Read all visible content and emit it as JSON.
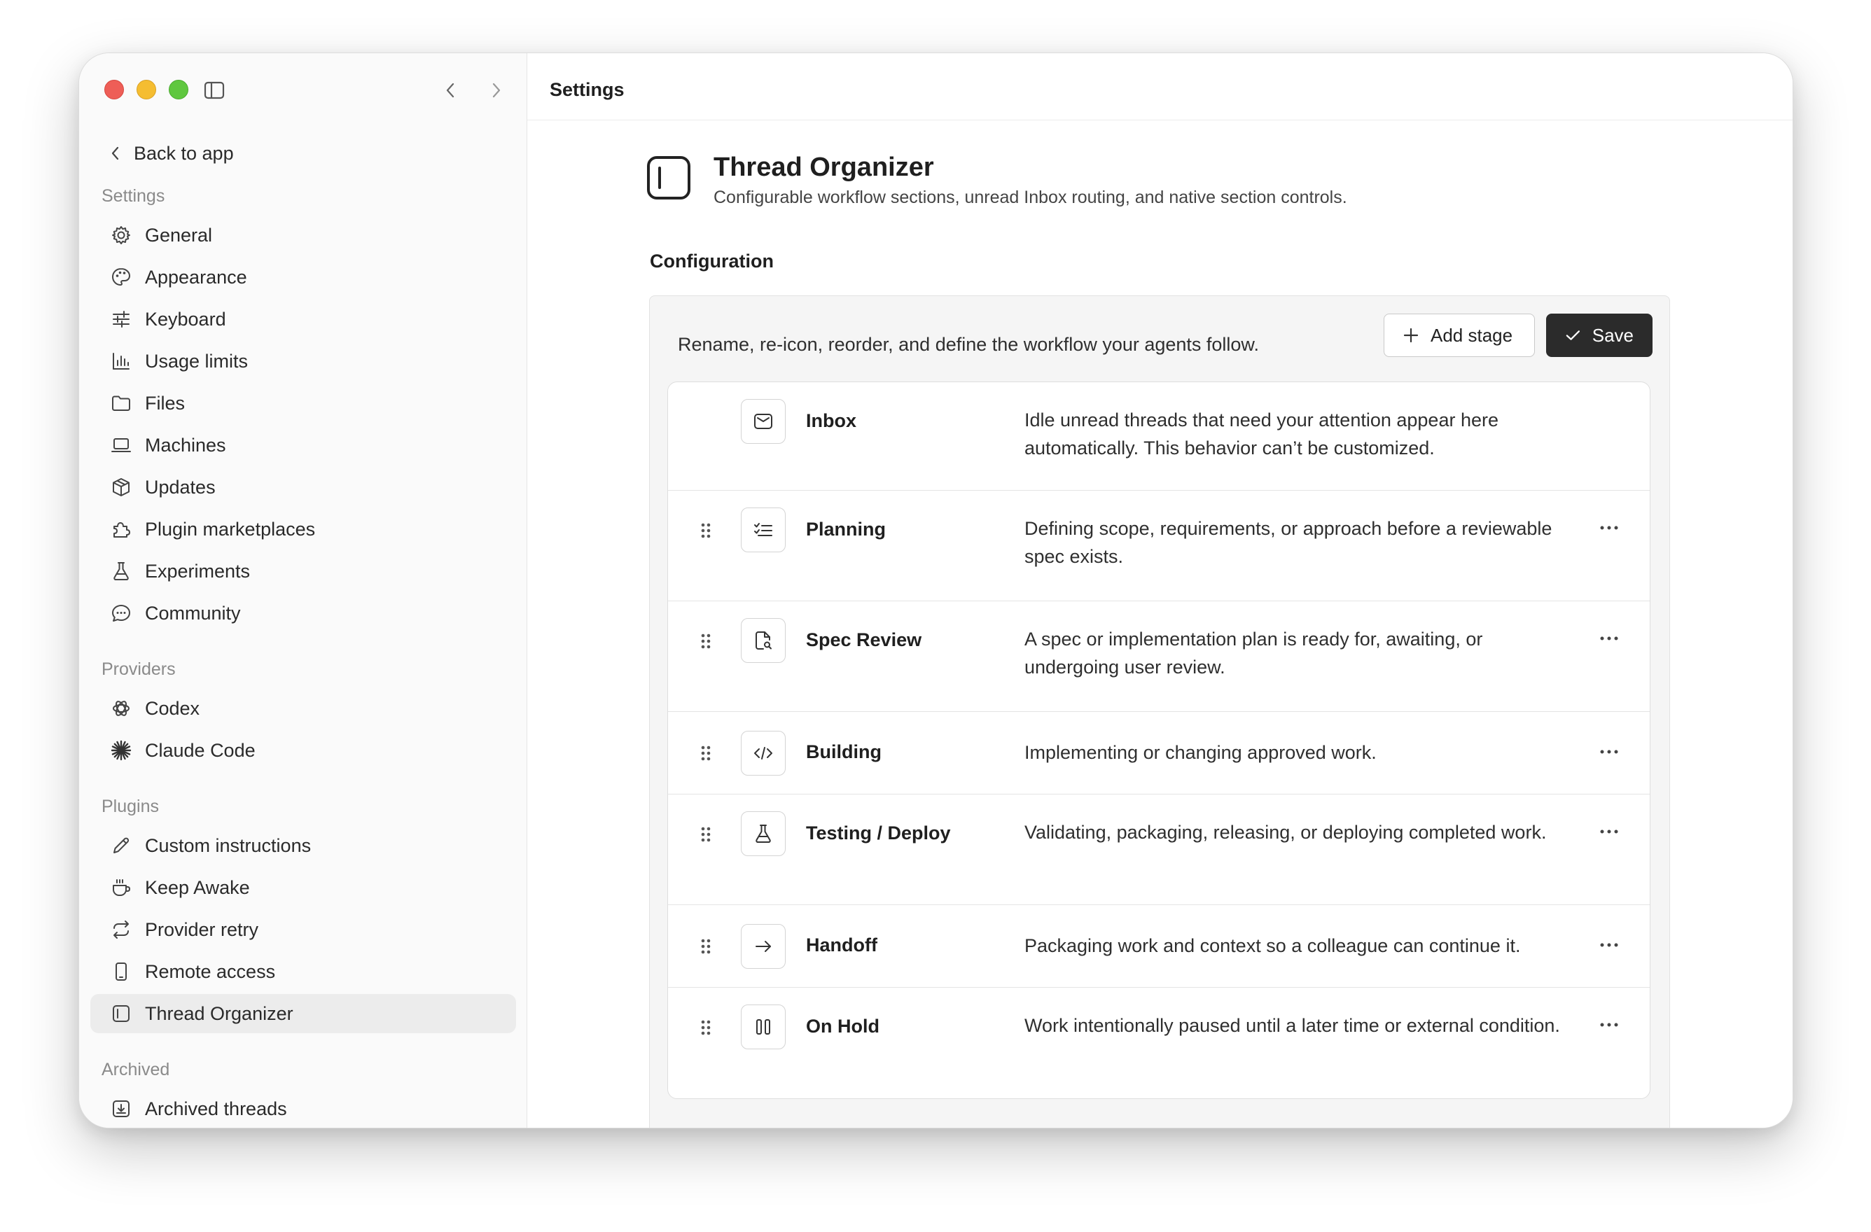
{
  "sidebar": {
    "back_label": "Back to app",
    "sections": [
      {
        "label": "Settings",
        "items": [
          {
            "label": "General",
            "icon": "gear-icon"
          },
          {
            "label": "Appearance",
            "icon": "palette-icon"
          },
          {
            "label": "Keyboard",
            "icon": "sliders-icon"
          },
          {
            "label": "Usage limits",
            "icon": "bar-chart-icon"
          },
          {
            "label": "Files",
            "icon": "folder-icon"
          },
          {
            "label": "Machines",
            "icon": "laptop-icon"
          },
          {
            "label": "Updates",
            "icon": "package-icon"
          },
          {
            "label": "Plugin marketplaces",
            "icon": "puzzle-icon"
          },
          {
            "label": "Experiments",
            "icon": "flask-icon"
          },
          {
            "label": "Community",
            "icon": "chat-bubble-icon"
          }
        ]
      },
      {
        "label": "Providers",
        "items": [
          {
            "label": "Codex",
            "icon": "openai-logo-icon"
          },
          {
            "label": "Claude Code",
            "icon": "claude-star-icon"
          }
        ]
      },
      {
        "label": "Plugins",
        "items": [
          {
            "label": "Custom instructions",
            "icon": "pencil-icon"
          },
          {
            "label": "Keep Awake",
            "icon": "coffee-cup-icon"
          },
          {
            "label": "Provider retry",
            "icon": "retry-arrows-icon"
          },
          {
            "label": "Remote access",
            "icon": "phone-icon"
          },
          {
            "label": "Thread Organizer",
            "icon": "thread-organizer-icon",
            "active": true
          }
        ]
      },
      {
        "label": "Archived",
        "items": [
          {
            "label": "Archived threads",
            "icon": "archive-box-icon"
          }
        ]
      }
    ]
  },
  "main": {
    "title": "Settings",
    "plugin": {
      "title": "Thread Organizer",
      "subtitle": "Configurable workflow sections, unread Inbox routing, and native section controls."
    },
    "config": {
      "label": "Configuration",
      "description": "Rename, re-icon, reorder, and define the workflow your agents follow.",
      "add_stage_label": "Add stage",
      "save_label": "Save"
    },
    "stages": [
      {
        "name": "Inbox",
        "icon": "inbox-icon",
        "description": "Idle unread threads that need your attention appear here automatically. This behavior can’t be customized.",
        "locked": true
      },
      {
        "name": "Planning",
        "icon": "checklist-icon",
        "description": "Defining scope, requirements, or approach before a reviewable spec exists."
      },
      {
        "name": "Spec Review",
        "icon": "document-search-icon",
        "description": "A spec or implementation plan is ready for, awaiting, or undergoing user review."
      },
      {
        "name": "Building",
        "icon": "code-icon",
        "description": "Implementing or changing approved work."
      },
      {
        "name": "Testing / Deploy",
        "icon": "flask-icon",
        "description": "Validating, packaging, releasing, or deploying completed work."
      },
      {
        "name": "Handoff",
        "icon": "arrow-right-icon",
        "description": "Packaging work and context so a colleague can continue it."
      },
      {
        "name": "On Hold",
        "icon": "pause-icon",
        "description": "Work intentionally paused until a later time or external condition."
      }
    ]
  }
}
